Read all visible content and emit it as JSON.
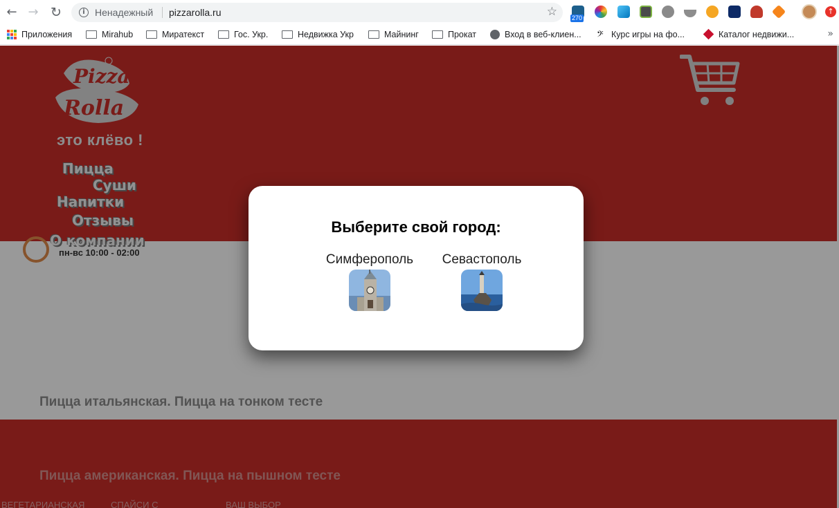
{
  "browser": {
    "security_label": "Ненадежный",
    "url": "pizzarolla.ru",
    "extension_badge": "270",
    "bookmarks": [
      {
        "label": "Приложения",
        "icon": "apps-icon"
      },
      {
        "label": "Mirahub",
        "icon": "folder-icon"
      },
      {
        "label": "Миратекст",
        "icon": "folder-icon"
      },
      {
        "label": "Гос. Укр.",
        "icon": "folder-icon"
      },
      {
        "label": "Недвижка Укр",
        "icon": "folder-icon"
      },
      {
        "label": "Майнинг",
        "icon": "folder-icon"
      },
      {
        "label": "Прокат",
        "icon": "folder-icon"
      },
      {
        "label": "Вход в веб-клиен...",
        "icon": "globe-icon"
      },
      {
        "label": "Курс игры на фо...",
        "icon": "bass-clef-icon"
      },
      {
        "label": "Каталог недвижи...",
        "icon": "diamond-icon"
      }
    ],
    "overflow_label": "»"
  },
  "site": {
    "logo_text_top": "Pizza",
    "logo_text_bottom": "Rolla",
    "slogan": "это клёво !",
    "menu": [
      "Пицца",
      "Суши",
      "Напитки",
      "Отзывы",
      "О компании"
    ],
    "hours": "пн-вс 10:00 - 02:00",
    "section_italian": "Пицца итальянская. Пицца на тонком тесте",
    "section_american": "Пицца американская. Пицца на пышном тесте",
    "categories": [
      "ВЕГЕТАРИАНСКАЯ",
      "СПАЙСИ С",
      "ВАШ ВЫБОР"
    ]
  },
  "modal": {
    "title": "Выберите свой город:",
    "cities": [
      {
        "name": "Симферополь",
        "icon": "clock-tower-photo"
      },
      {
        "name": "Севастополь",
        "icon": "monument-sea-photo"
      }
    ]
  },
  "colors": {
    "brand_red": "#ca2d28",
    "overlay": "rgba(0,0,0,0.4)"
  }
}
